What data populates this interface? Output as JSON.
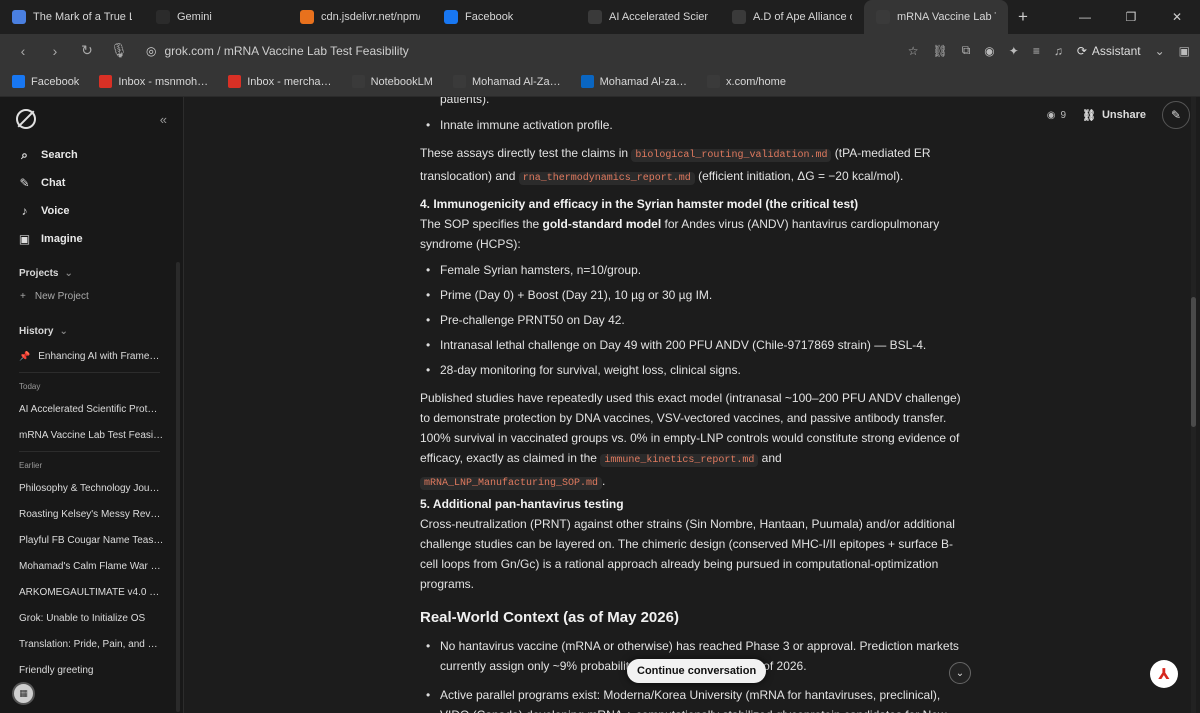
{
  "browser": {
    "tabs": [
      {
        "label": "The Mark of a True Lor",
        "icon": "doc-icon",
        "color": "#4a7fe0"
      },
      {
        "label": "Gemini",
        "icon": "gemini-icon",
        "color": "#2b2b2b"
      },
      {
        "label": "cdn.jsdelivr.net/npm/(",
        "icon": "shield-icon",
        "color": "#e8711d"
      },
      {
        "label": "Facebook",
        "icon": "facebook-icon",
        "color": "#1877f2"
      },
      {
        "label": "AI Accelerated Scientif",
        "icon": "grok-icon",
        "color": "#3a3a3a"
      },
      {
        "label": "A.D of Ape Alliance on",
        "icon": "x-icon",
        "color": "#3a3a3a"
      },
      {
        "label": "mRNA Vaccine Lab Te",
        "icon": "grok-icon",
        "color": "#3a3a3a"
      }
    ],
    "active_tab_index": 6,
    "url": "grok.com / mRNA Vaccine Lab Test Feasibility",
    "assistant_label": "Assistant",
    "bookmarks": [
      {
        "label": "Facebook",
        "icon": "facebook-icon",
        "color": "#1877f2"
      },
      {
        "label": "Inbox - msnmoh…",
        "icon": "gmail-icon",
        "color": "#d93025"
      },
      {
        "label": "Inbox - mercha…",
        "icon": "gmail-icon",
        "color": "#d93025"
      },
      {
        "label": "NotebookLM",
        "icon": "notebooklm-icon",
        "color": "#3a3a3a"
      },
      {
        "label": "Mohamad Al-Za…",
        "icon": "academia-icon",
        "color": "#3a3a3a"
      },
      {
        "label": "Mohamad Al-za…",
        "icon": "linkedin-icon",
        "color": "#0a66c2"
      },
      {
        "label": "x.com/home",
        "icon": "x-icon",
        "color": "#3a3a3a"
      }
    ]
  },
  "sidebar": {
    "nav": [
      {
        "label": "Search",
        "icon": "search-icon"
      },
      {
        "label": "Chat",
        "icon": "chat-icon"
      },
      {
        "label": "Voice",
        "icon": "voice-icon"
      },
      {
        "label": "Imagine",
        "icon": "imagine-icon"
      }
    ],
    "projects_label": "Projects",
    "new_project_label": "New Project",
    "history_label": "History",
    "pinned": "Enhancing AI with Frame…",
    "today_label": "Today",
    "today": [
      "AI Accelerated Scientific Prot…",
      "mRNA Vaccine Lab Test Feasi…"
    ],
    "earlier_label": "Earlier",
    "earlier": [
      "Philosophy & Technology Jou…",
      "Roasting Kelsey's Messy Rev…",
      "Playful FB Cougar Name Teas…",
      "Mohamad's Calm Flame War …",
      "ARKOMEGAULTIMATE v4.0 …",
      "Grok: Unable to Initialize OS",
      "Translation: Pride, Pain, and …",
      "Friendly greeting"
    ]
  },
  "header": {
    "views": "9",
    "unshare_label": "Unshare"
  },
  "content": {
    "top_fragment": "patients).",
    "bullet_innate": "Innate immune activation profile.",
    "assays_a": "These assays directly test the claims in ",
    "assays_code1": "biological_routing_validation.md",
    "assays_b": " (tPA-mediated ER translocation) and ",
    "assays_code2": "rna_thermodynamics_report.md",
    "assays_c": " (efficient initiation, ΔG = −20 kcal/mol).",
    "sec4_title": "4. Immunogenicity and efficacy in the Syrian hamster model (the critical test)",
    "sec4_a": "The SOP specifies the ",
    "sec4_bold": "gold-standard model",
    "sec4_b": " for Andes virus (ANDV) hantavirus cardiopulmonary syndrome (HCPS):",
    "sec4_bullets": [
      "Female Syrian hamsters, n=10/group.",
      "Prime (Day 0) + Boost (Day 21), 10 µg or 30 µg IM.",
      "Pre-challenge PRNT50 on Day 42.",
      "Intranasal lethal challenge on Day 49 with 200 PFU ANDV (Chile-9717869 strain) — BSL-4.",
      "28-day monitoring for survival, weight loss, clinical signs."
    ],
    "published_a": "Published studies have repeatedly used this exact model (intranasal ~100–200 PFU ANDV challenge) to demonstrate protection by DNA vaccines, VSV-vectored vaccines, and passive antibody transfer. 100% survival in vaccinated groups vs. 0% in empty-LNP controls would constitute strong evidence of efficacy, exactly as claimed in the ",
    "published_code1": "immune_kinetics_report.md",
    "published_b": " and ",
    "published_code2": "mRNA_LNP_Manufacturing_SOP.md",
    "published_c": ".",
    "sec5_title": "5. Additional pan-hantavirus testing",
    "sec5_text": "Cross-neutralization (PRNT) against other strains (Sin Nombre, Hantaan, Puumala) and/or additional challenge studies can be layered on. The chimeric design (conserved MHC-I/II epitopes + surface B-cell loops from Gn/Gc) is a rational approach already being pursued in computational-optimization programs.",
    "h2": "Real-World Context (as of May 2026)",
    "rw_bullet1": "No hantavirus vaccine (mRNA or otherwise) has reached Phase 3 or approval. Prediction markets currently assign only ~9% probability of any approval by end of 2026.",
    "rw_bullet2": "Active parallel programs exist: Moderna/Korea University (mRNA for hantaviruses, preclinical), VIDO (Canada) developing mRNA + computationally stabilized glycoprotein candidates for New World hantaviruses (Andes/Sin Nombre focus), and multiple DNA/mRNA studies showing robust"
  },
  "continue_label": "Continue conversation"
}
